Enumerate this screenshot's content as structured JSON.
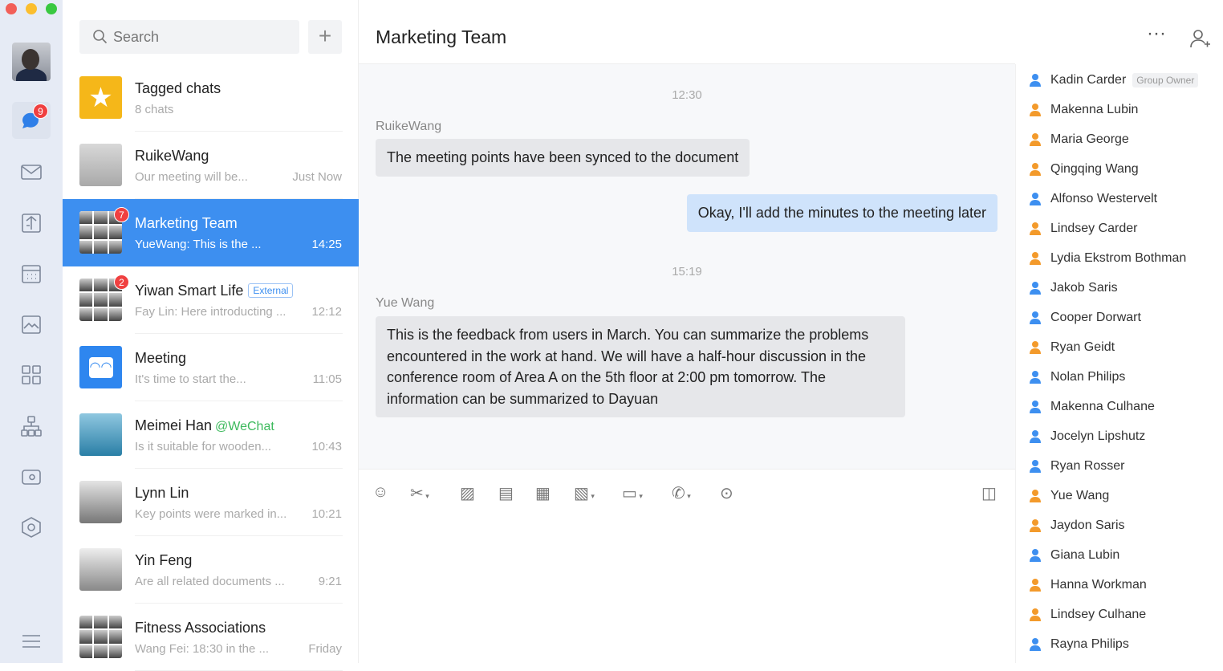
{
  "window": {
    "controls": [
      "#f25f58",
      "#fbbe2e",
      "#39c840"
    ]
  },
  "rail": {
    "chat_badge": "9",
    "items": [
      "chat-icon",
      "mail-icon",
      "docs-icon",
      "calendar-icon",
      "photos-icon",
      "apps-icon",
      "org-icon",
      "video-icon",
      "workplace-icon",
      "menu-icon"
    ]
  },
  "search": {
    "placeholder": "Search"
  },
  "chats": [
    {
      "name": "Tagged chats",
      "preview": "8 chats",
      "time": ""
    },
    {
      "name": "RuikeWang",
      "preview": "Our meeting will be...",
      "time": "Just Now"
    },
    {
      "name": "Marketing Team",
      "preview": "YueWang: This is the ...",
      "time": "14:25",
      "badge": "7",
      "selected": true
    },
    {
      "name": "Yiwan Smart Life",
      "tag": "External",
      "preview": "Fay Lin: Here introducting ...",
      "time": "12:12",
      "badge": "2"
    },
    {
      "name": "Meeting",
      "preview": "It's time to start the...",
      "time": "11:05"
    },
    {
      "name": "Meimei Han",
      "suffix": "@WeChat",
      "preview": "Is it suitable for wooden...",
      "time": "10:43"
    },
    {
      "name": "Lynn Lin",
      "preview": "Key points were marked in...",
      "time": "10:21"
    },
    {
      "name": "Yin Feng",
      "preview": "Are all related documents ...",
      "time": "9:21"
    },
    {
      "name": "Fitness Associations",
      "preview": "Wang Fei: 18:30 in the ...",
      "time": "Friday"
    }
  ],
  "conversation": {
    "title": "Marketing Team",
    "messages": [
      {
        "timestamp": "12:30",
        "sender": "RuikeWang",
        "text": "The meeting points have been synced to the document"
      },
      {
        "mine": true,
        "text": "Okay, I'll add the minutes to the meeting later"
      },
      {
        "timestamp": "15:19",
        "sender": "Yue Wang",
        "text": "This is the feedback from users in March. You can summarize the problems encountered in the work at hand. We will have a half-hour discussion in the conference room of Area A on the 5th floor at 2:00 pm tomorrow. The information can be summarized to Dayuan"
      }
    ]
  },
  "members": {
    "owner_label": "Group Owner",
    "list": [
      {
        "name": "Kadin Carder",
        "color": "#3d8ff0",
        "owner": true
      },
      {
        "name": "Makenna Lubin",
        "color": "#f39a2b"
      },
      {
        "name": "Maria George",
        "color": "#f39a2b"
      },
      {
        "name": "Qingqing Wang",
        "color": "#f39a2b"
      },
      {
        "name": "Alfonso Westervelt",
        "color": "#3d8ff0"
      },
      {
        "name": "Lindsey Carder",
        "color": "#f39a2b"
      },
      {
        "name": "Lydia Ekstrom Bothman",
        "color": "#f39a2b"
      },
      {
        "name": "Jakob Saris",
        "color": "#3d8ff0"
      },
      {
        "name": "Cooper Dorwart",
        "color": "#3d8ff0"
      },
      {
        "name": "Ryan Geidt",
        "color": "#f39a2b"
      },
      {
        "name": "Nolan Philips",
        "color": "#3d8ff0"
      },
      {
        "name": "Makenna Culhane",
        "color": "#3d8ff0"
      },
      {
        "name": "Jocelyn Lipshutz",
        "color": "#3d8ff0"
      },
      {
        "name": "Ryan Rosser",
        "color": "#3d8ff0"
      },
      {
        "name": "Yue Wang",
        "color": "#f39a2b"
      },
      {
        "name": "Jaydon Saris",
        "color": "#f39a2b"
      },
      {
        "name": "Giana Lubin",
        "color": "#3d8ff0"
      },
      {
        "name": "Hanna Workman",
        "color": "#f39a2b"
      },
      {
        "name": "Lindsey Culhane",
        "color": "#f39a2b"
      },
      {
        "name": "Rayna Philips",
        "color": "#3d8ff0"
      }
    ]
  },
  "toolbar": [
    "emoji-icon",
    "scissors-icon",
    "image-icon",
    "document-icon",
    "calendar-icon",
    "photo-album-icon",
    "folder-icon",
    "phone-icon",
    "more-icon",
    "history-icon"
  ]
}
